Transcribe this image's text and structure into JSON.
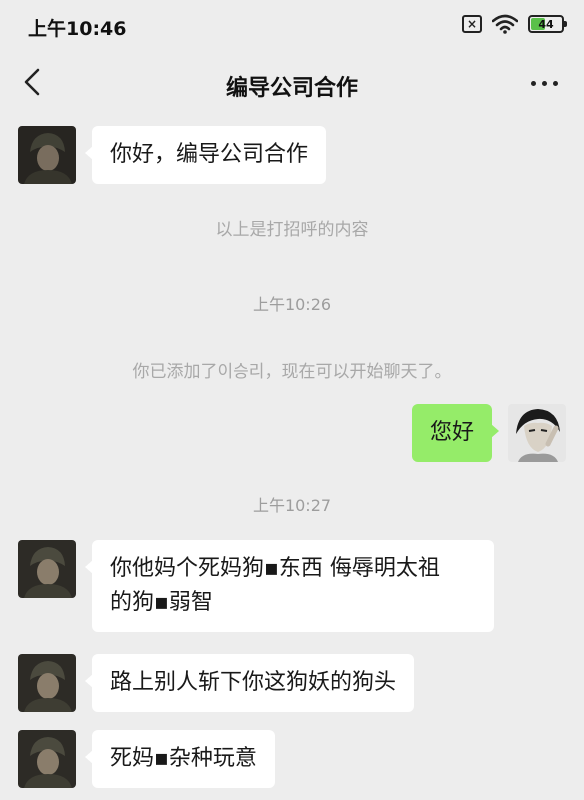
{
  "status_bar": {
    "time": "上午10:46",
    "sim_label": "×",
    "battery_level": "44",
    "icons": [
      "sim-no-signal-icon",
      "wifi-icon",
      "battery-icon"
    ],
    "battery_color": "#5ac04a"
  },
  "header": {
    "title": "编导公司合作",
    "back_icon": "chevron-left-icon",
    "more_icon": "more-dots-icon"
  },
  "colors": {
    "background": "#ededed",
    "bubble_incoming": "#ffffff",
    "bubble_outgoing": "#95ec69"
  },
  "messages": [
    {
      "type": "incoming",
      "text": "你好，编导公司合作"
    },
    {
      "type": "system",
      "text": "以上是打招呼的内容"
    },
    {
      "type": "time",
      "text": "上午10:26"
    },
    {
      "type": "system",
      "text": "你已添加了이승리，现在可以开始聊天了。"
    },
    {
      "type": "outgoing",
      "text": "您好"
    },
    {
      "type": "time",
      "text": "上午10:27"
    },
    {
      "type": "incoming",
      "line1": "你他妈个死妈狗▪东西 侮辱明太祖",
      "line2": "的狗▪弱智"
    },
    {
      "type": "incoming",
      "text": "路上别人斩下你这狗妖的狗头"
    },
    {
      "type": "incoming",
      "text": "死妈▪杂种玩意"
    }
  ]
}
